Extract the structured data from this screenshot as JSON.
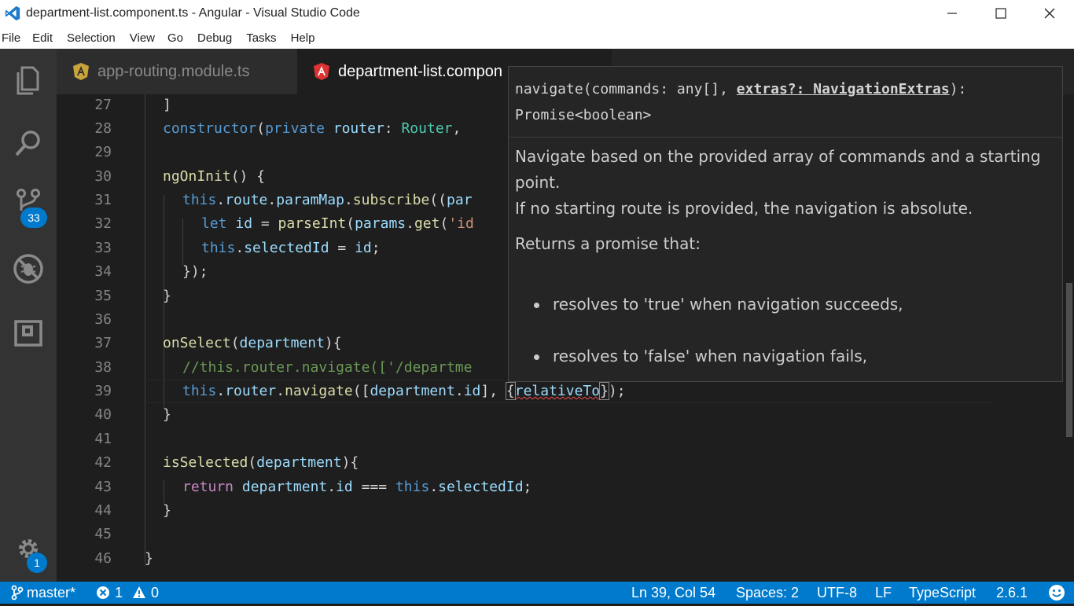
{
  "window": {
    "title": "department-list.component.ts - Angular - Visual Studio Code"
  },
  "menu": [
    "File",
    "Edit",
    "Selection",
    "View",
    "Go",
    "Debug",
    "Tasks",
    "Help"
  ],
  "activity": {
    "scm_badge": "33",
    "settings_badge": "1"
  },
  "tabs": [
    {
      "label": "app-routing.module.ts",
      "active": false
    },
    {
      "label": "department-list.compon",
      "active": true
    }
  ],
  "editor": {
    "lines": [
      {
        "num": "27"
      },
      {
        "num": "28"
      },
      {
        "num": "29"
      },
      {
        "num": "30"
      },
      {
        "num": "31"
      },
      {
        "num": "32"
      },
      {
        "num": "33"
      },
      {
        "num": "34"
      },
      {
        "num": "35"
      },
      {
        "num": "36"
      },
      {
        "num": "37"
      },
      {
        "num": "38"
      },
      {
        "num": "39"
      },
      {
        "num": "40"
      },
      {
        "num": "41"
      },
      {
        "num": "42"
      },
      {
        "num": "43"
      },
      {
        "num": "44"
      },
      {
        "num": "45"
      },
      {
        "num": "46"
      }
    ],
    "code": {
      "l27": "]",
      "l28a": "constructor",
      "l28b": "(",
      "l28c": "private",
      "l28d": " router",
      "l28e": ": ",
      "l28f": "Router",
      "l28g": ",",
      "l30a": "ngOnInit",
      "l30b": "() {",
      "l31a": "this",
      "l31b": ".",
      "l31c": "route",
      "l31d": ".",
      "l31e": "paramMap",
      "l31f": ".",
      "l31g": "subscribe",
      "l31h": "((",
      "l31i": "par",
      "l32a": "let",
      "l32b": " id",
      "l32c": " = ",
      "l32d": "parseInt",
      "l32e": "(",
      "l32f": "params",
      "l32g": ".",
      "l32h": "get",
      "l32i": "(",
      "l32j": "'id",
      "l33a": "this",
      "l33b": ".",
      "l33c": "selectedId",
      "l33d": " = ",
      "l33e": "id",
      "l33f": ";",
      "l34": "});",
      "l35": "}",
      "l37a": "onSelect",
      "l37b": "(",
      "l37c": "department",
      "l37d": "){",
      "l38": "//this.router.navigate(['/departme",
      "l39a": "this",
      "l39b": ".",
      "l39c": "router",
      "l39d": ".",
      "l39e": "navigate",
      "l39f": "([",
      "l39g": "department",
      "l39h": ".",
      "l39i": "id",
      "l39j": "], ",
      "l39k": "{",
      "l39l": "relativeTo",
      "l39m": "}",
      "l39n": ");",
      "l40": "}",
      "l42a": "isSelected",
      "l42b": "(",
      "l42c": "department",
      "l42d": "){",
      "l43a": "return",
      "l43b": " department",
      "l43c": ".",
      "l43d": "id",
      "l43e": " === ",
      "l43f": "this",
      "l43g": ".",
      "l43h": "selectedId",
      "l43i": ";",
      "l44": "}",
      "l46": "}"
    }
  },
  "hover": {
    "sig_part1": "navigate(commands: any[], ",
    "sig_param": "extras?: NavigationExtras",
    "sig_part2": "):",
    "sig_return": "Promise<boolean>",
    "doc1": "Navigate based on the provided array of commands and a starting point.",
    "doc2": "If no starting route is provided, the navigation is absolute.",
    "doc3": "Returns a promise that:",
    "bullets": [
      "resolves to 'true' when navigation succeeds,",
      "resolves to 'false' when navigation fails,"
    ]
  },
  "status": {
    "branch": "master*",
    "errors": "1",
    "warnings": "0",
    "position": "Ln 39, Col 54",
    "spaces": "Spaces: 2",
    "encoding": "UTF-8",
    "eol": "LF",
    "language": "TypeScript",
    "version": "2.6.1"
  }
}
